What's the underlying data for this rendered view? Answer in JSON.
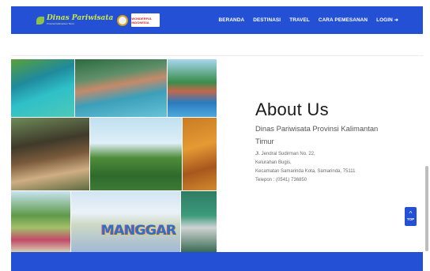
{
  "header": {
    "logo_main": "Dinas Pariwisata",
    "logo_sub": "Provinsi Kalimantan Timur",
    "wi_badge": "WONDERFUL INDONESIA"
  },
  "nav": {
    "items": [
      {
        "label": "BERANDA"
      },
      {
        "label": "DESTINASI"
      },
      {
        "label": "TRAVEL"
      },
      {
        "label": "CARA PEMESANAN"
      },
      {
        "label": "LOGIN"
      }
    ]
  },
  "mosaic": {
    "sign_text": "MANGGAR"
  },
  "about": {
    "title": "About Us",
    "subtitle": "Dinas Pariwisata Provinsi Kalimantan Timur",
    "address": [
      "Jl. Jendral Sudirman No. 22,",
      "Kelurahan Bugis,",
      "Kecamatan Samarinda Kota, Samarinda, 75111",
      "Telepon : (0541) 736850"
    ]
  },
  "top_button": {
    "label": "TOP"
  },
  "colors": {
    "brand_blue": "#2450d6"
  },
  "icons": [
    "leaf-icon",
    "seal-icon",
    "login-icon",
    "chevron-up-icon"
  ]
}
